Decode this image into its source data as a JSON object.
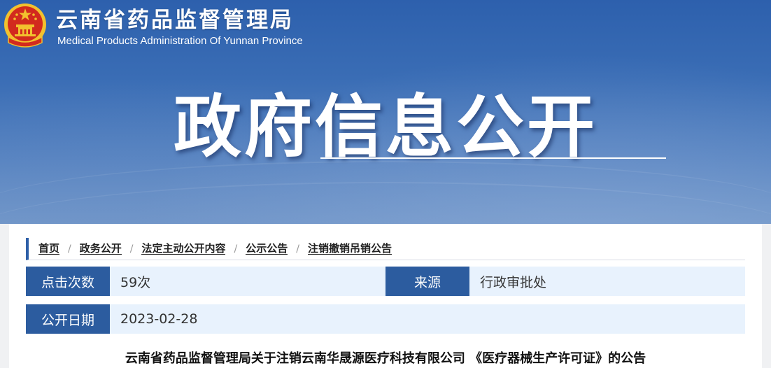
{
  "header": {
    "org_name_cn": "云南省药品监督管理局",
    "org_name_en": "Medical Products Administration Of Yunnan Province",
    "section_title": "政府信息公开",
    "emblem_icon": "national-emblem-icon"
  },
  "breadcrumb": {
    "items": [
      "首页",
      "政务公开",
      "法定主动公开内容",
      "公示公告",
      "注销撤销吊销公告"
    ],
    "separator": "/"
  },
  "info": {
    "clicks_label": "点击次数",
    "clicks_value": "59次",
    "source_label": "来源",
    "source_value": "行政审批处",
    "date_label": "公开日期",
    "date_value": "2023-02-28"
  },
  "article": {
    "title": "云南省药品监督管理局关于注销云南华晟源医疗科技有限公司 《医疗器械生产许可证》的公告"
  },
  "colors": {
    "banner_blue": "#2d60ad",
    "label_blue": "#2c5c9f",
    "row_bg": "#e8f2fd",
    "emblem_red": "#d22a1e",
    "emblem_gold": "#f2c12e"
  }
}
